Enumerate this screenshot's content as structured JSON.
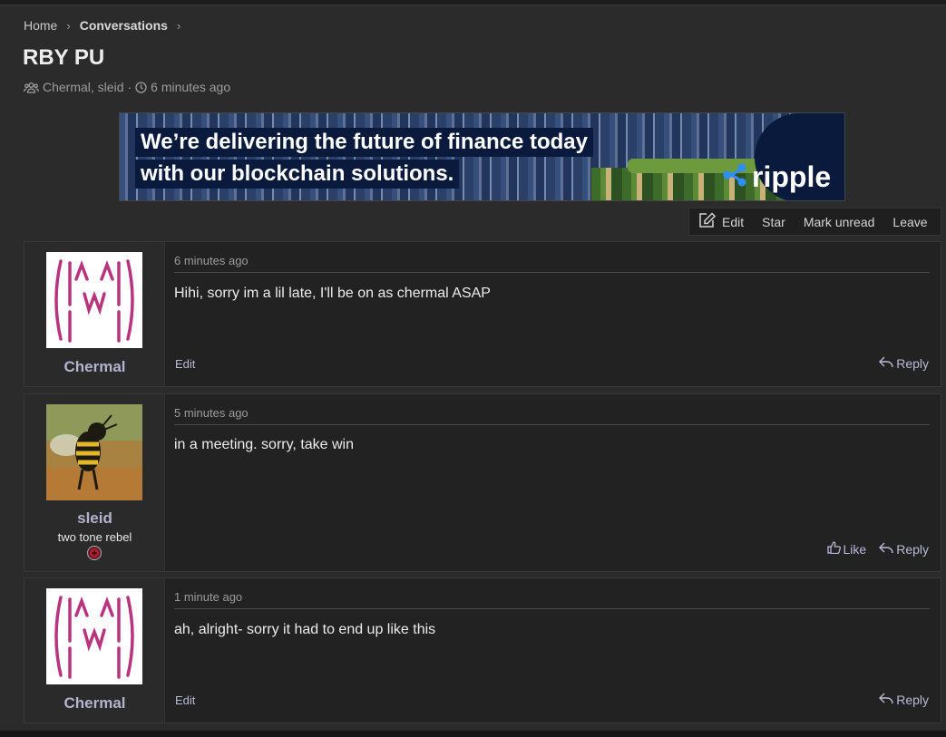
{
  "breadcrumb": {
    "home": "Home",
    "current": "Conversations"
  },
  "page": {
    "title": "RBY PU",
    "participants": "Chermal, sleid",
    "separator": "·",
    "time": "6 minutes ago"
  },
  "ad": {
    "line1": "We’re delivering the future of finance today",
    "line2": "with our blockchain solutions.",
    "brand": "ripple"
  },
  "actions": {
    "edit": "Edit",
    "star": "Star",
    "mark_unread": "Mark unread",
    "leave": "Leave"
  },
  "messages": [
    {
      "author": "Chermal",
      "user_title": "",
      "time": "6 minutes ago",
      "text": "Hihi, sorry im a lil late, I'll be on as chermal ASAP",
      "edit": "Edit",
      "reply": "Reply",
      "like": ""
    },
    {
      "author": "sleid",
      "user_title": "two tone rebel",
      "time": "5 minutes ago",
      "text": "in a meeting. sorry, take win",
      "edit": "",
      "reply": "Reply",
      "like": "Like"
    },
    {
      "author": "Chermal",
      "user_title": "",
      "time": "1 minute ago",
      "text": "ah, alright- sorry it had to end up like this",
      "edit": "Edit",
      "reply": "Reply",
      "like": ""
    }
  ],
  "colors": {
    "background": "#2b2b2b",
    "username": "#b3b3cf",
    "link": "#b9b9d8",
    "ripple_blue": "#2e8dff"
  }
}
